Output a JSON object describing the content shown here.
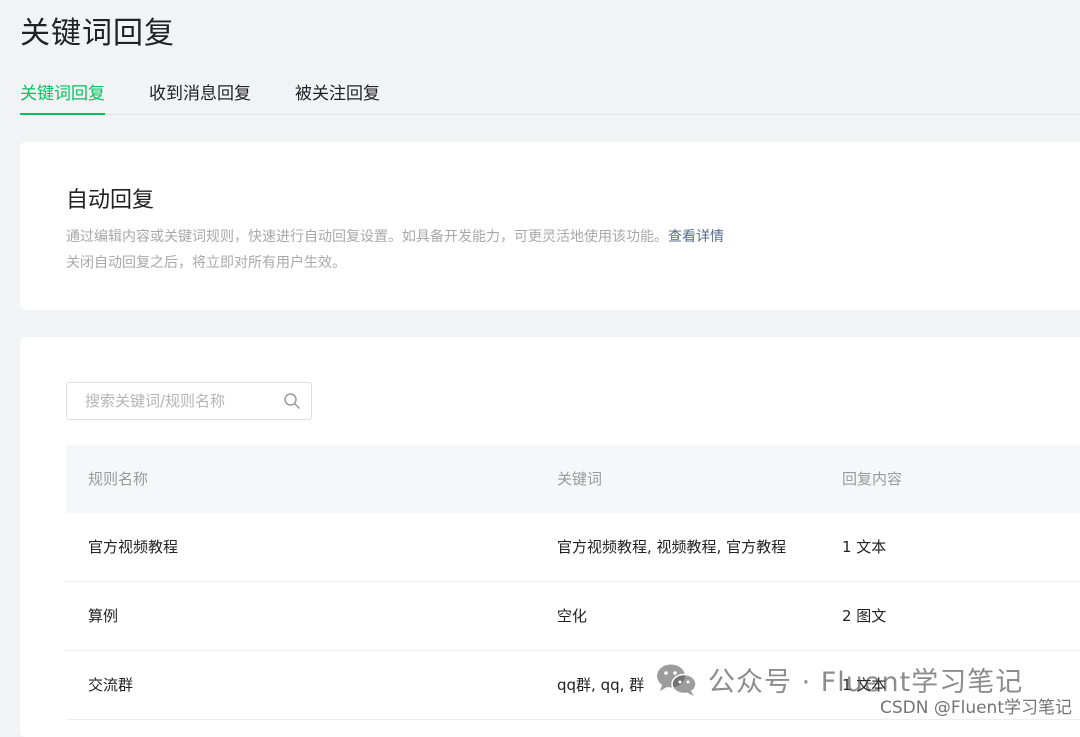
{
  "page": {
    "title": "关键词回复"
  },
  "tabs": [
    {
      "label": "关键词回复",
      "active": true
    },
    {
      "label": "收到消息回复",
      "active": false
    },
    {
      "label": "被关注回复",
      "active": false
    }
  ],
  "auto_reply": {
    "title": "自动回复",
    "description_line1": "通过编辑内容或关键词规则，快速进行自动回复设置。如具备开发能力，可更灵活地使用该功能。",
    "detail_link": "查看详情",
    "description_line2": "关闭自动回复之后，将立即对所有用户生效。"
  },
  "search": {
    "placeholder": "搜索关键词/规则名称",
    "value": "",
    "icon": "search-icon"
  },
  "table": {
    "headers": [
      "规则名称",
      "关键词",
      "回复内容"
    ],
    "rows": [
      {
        "name": "官方视频教程",
        "keywords": "官方视频教程, 视频教程, 官方教程",
        "reply": "1 文本"
      },
      {
        "name": "算例",
        "keywords": "空化",
        "reply": "2 图文"
      },
      {
        "name": "交流群",
        "keywords": "qq群, qq, 群",
        "reply": "1 文本"
      }
    ]
  },
  "watermark": {
    "main": "公众号 · Fluent学习笔记",
    "sub": "CSDN @Fluent学习笔记",
    "icon": "wechat-icon"
  },
  "colors": {
    "accent": "#07c160",
    "link": "#576b95",
    "background": "#f2f3f5",
    "card": "#ffffff"
  }
}
